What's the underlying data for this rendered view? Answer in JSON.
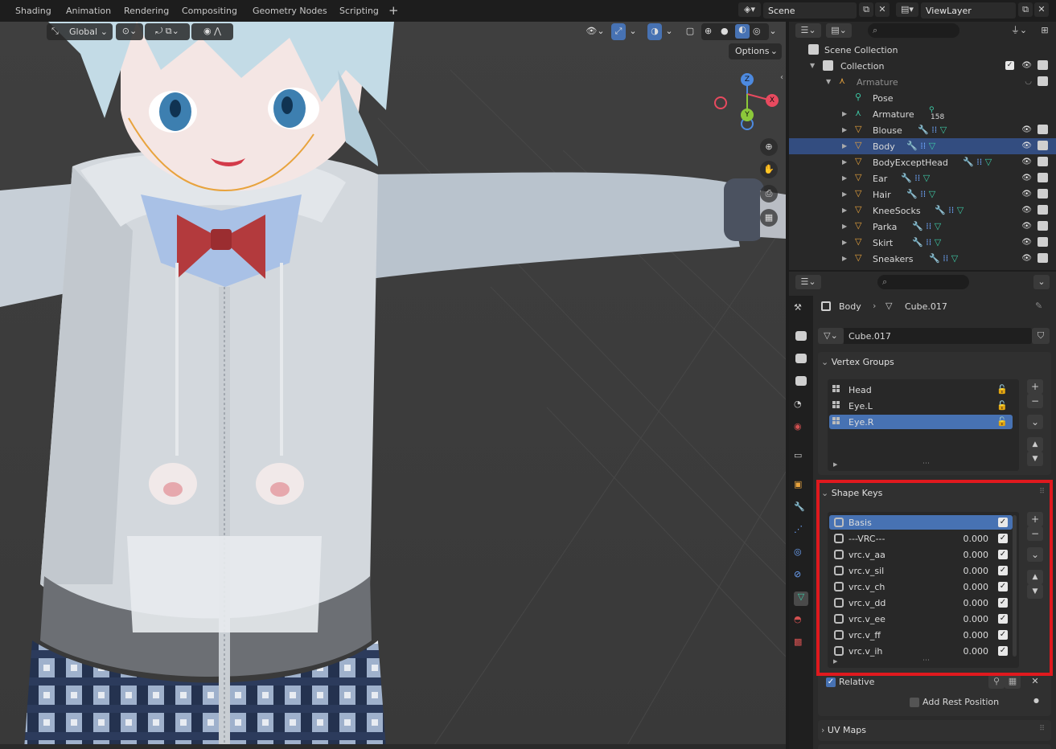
{
  "workspace_tabs": [
    "Shading",
    "Animation",
    "Rendering",
    "Compositing",
    "Geometry Nodes",
    "Scripting"
  ],
  "scene_name": "Scene",
  "view_layer": "ViewLayer",
  "viewport": {
    "orientation": "Global",
    "options_label": "Options",
    "gizmo_x": "X",
    "gizmo_y": "Y",
    "gizmo_z": "Z"
  },
  "outliner": {
    "root": "Scene Collection",
    "collection": "Collection",
    "armature_parent": "Armature",
    "pose": "Pose",
    "armature_child": "Armature",
    "bone_count": "158",
    "objects": [
      "Blouse",
      "Body",
      "BodyExceptHead",
      "Ear",
      "Hair",
      "KneeSocks",
      "Parka",
      "Skirt",
      "Sneakers"
    ],
    "selected_object": "Body"
  },
  "properties": {
    "breadcrumb_object": "Body",
    "breadcrumb_mesh": "Cube.017",
    "mesh_name": "Cube.017",
    "vertex_groups_title": "Vertex Groups",
    "vertex_groups": [
      "Head",
      "Eye.L",
      "Eye.R"
    ],
    "selected_vertex_group": "Eye.R",
    "shape_keys_title": "Shape Keys",
    "shape_keys": [
      {
        "name": "Basis",
        "value": ""
      },
      {
        "name": "---VRC---",
        "value": "0.000"
      },
      {
        "name": "vrc.v_aa",
        "value": "0.000"
      },
      {
        "name": "vrc.v_sil",
        "value": "0.000"
      },
      {
        "name": "vrc.v_ch",
        "value": "0.000"
      },
      {
        "name": "vrc.v_dd",
        "value": "0.000"
      },
      {
        "name": "vrc.v_ee",
        "value": "0.000"
      },
      {
        "name": "vrc.v_ff",
        "value": "0.000"
      },
      {
        "name": "vrc.v_ih",
        "value": "0.000"
      }
    ],
    "relative_label": "Relative",
    "relative_checked": true,
    "add_rest_label": "Add Rest Position",
    "uv_maps_title": "UV Maps"
  },
  "colors": {
    "highlight_box": "#e0191e",
    "selection": "#4772b3",
    "accent_orange": "#e8a33d",
    "mesh_green": "#3ec9a6"
  }
}
